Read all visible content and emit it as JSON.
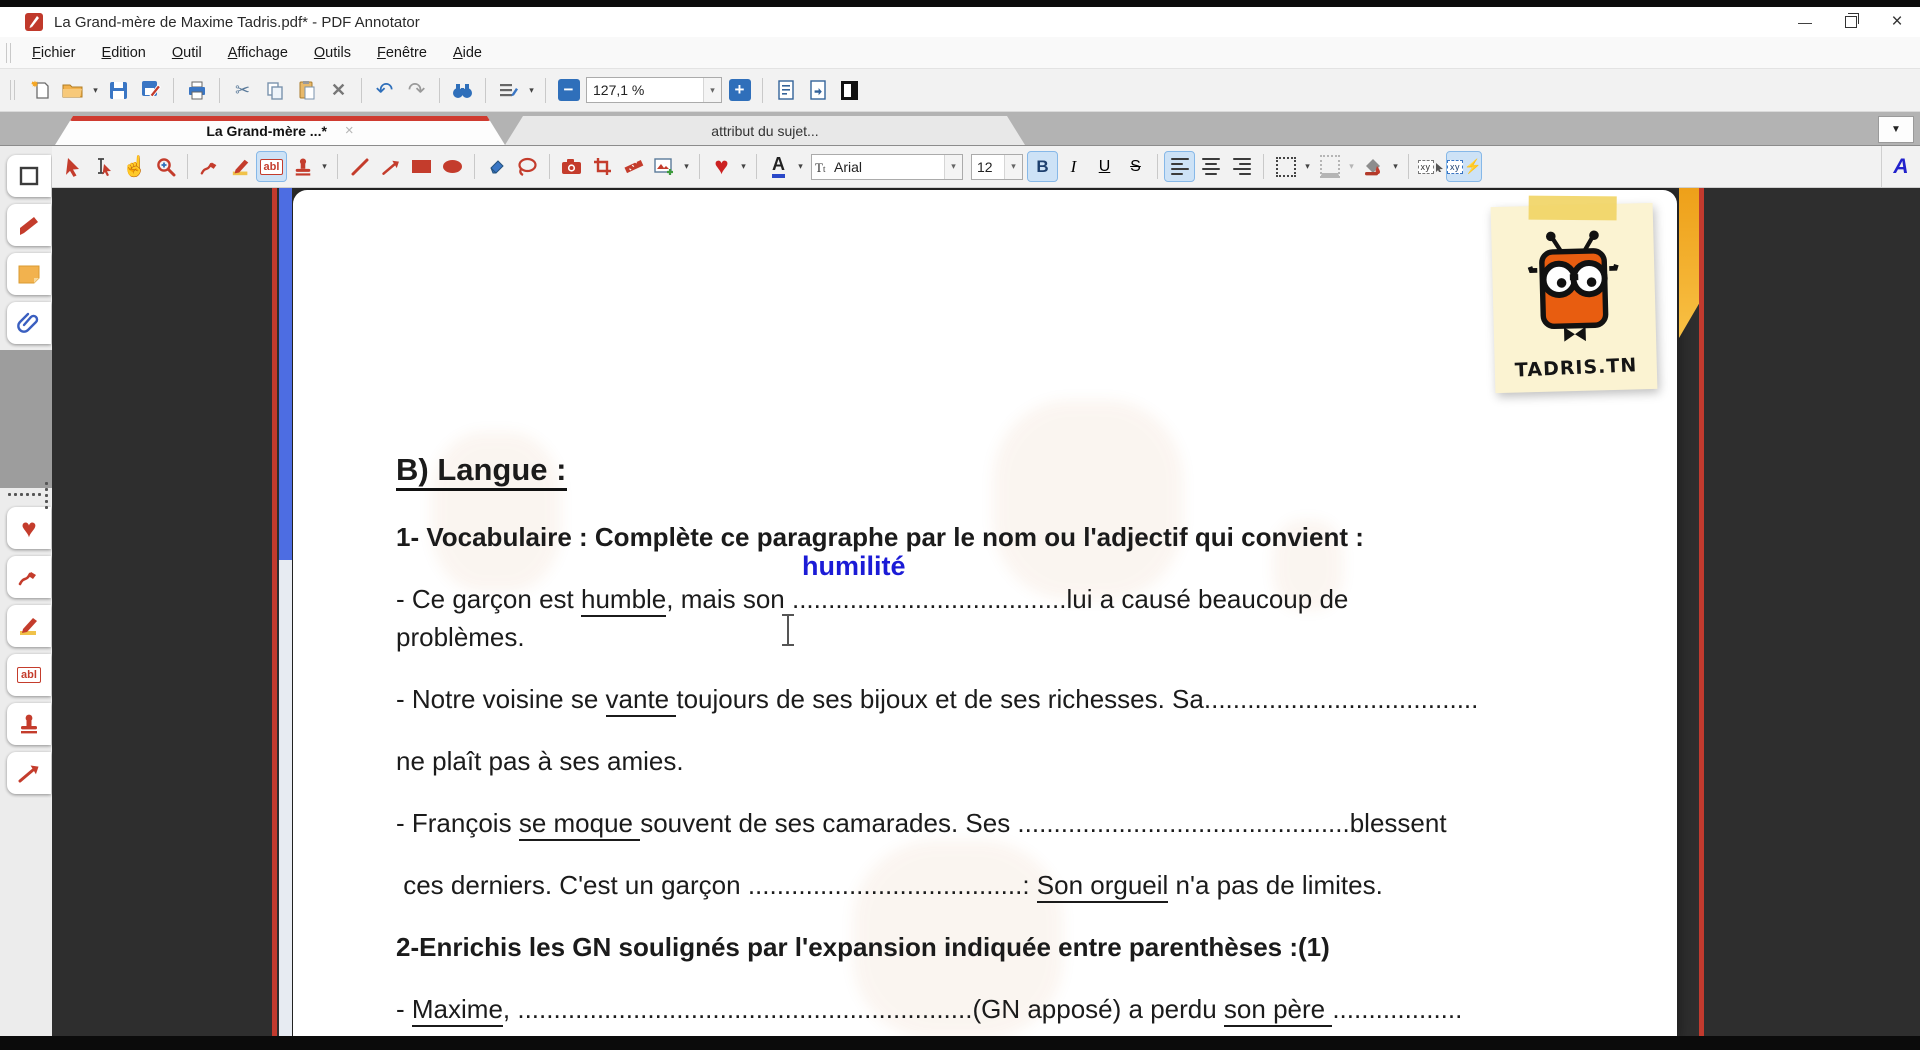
{
  "window": {
    "title": "La Grand-mère de Maxime Tadris.pdf* - PDF Annotator",
    "minimize_glyph": "—",
    "close_glyph": "×"
  },
  "menu": {
    "items": [
      "Fichier",
      "Edition",
      "Outil",
      "Affichage",
      "Outils",
      "Fenêtre",
      "Aide"
    ]
  },
  "toolbar": {
    "zoom_value": "127,1 %"
  },
  "tabs": [
    {
      "label": "La Grand-mère ...*",
      "active": true,
      "close_glyph": "×"
    },
    {
      "label": "attribut du sujet...",
      "active": false
    }
  ],
  "format_toolbar": {
    "text_tool_label": "abl",
    "font_color_letter": "A",
    "font_name": "Arial",
    "font_size": "12",
    "bold": "B",
    "italic": "I",
    "underline": "U",
    "strike": "S",
    "xy_label": "xy",
    "right_panel_letter": "A"
  },
  "sidebar": {
    "text_tool_label": "abl"
  },
  "document": {
    "logo_text": "TADRIS.TN",
    "lines": [
      {
        "cls": "h1",
        "segments": [
          {
            "t": "B) Langue :",
            "s": "bu"
          }
        ]
      },
      {
        "cls": "",
        "segments": [
          {
            "t": "1- Vocabulaire : Complète ce paragraphe par le nom ou l'adjectif qui convient :",
            "s": "b"
          }
        ]
      },
      {
        "cls": "tight",
        "segments": [
          {
            "t": "- Ce garçon est "
          },
          {
            "t": "humble",
            "s": "u"
          },
          {
            "t": ", mais son "
          },
          {
            "t": "......................................",
            "ann": "humilité"
          },
          {
            "t": "lui a causé beaucoup de"
          }
        ]
      },
      {
        "cls": "",
        "segments": [
          {
            "t": "problèmes."
          }
        ]
      },
      {
        "cls": "",
        "segments": [
          {
            "t": "- Notre voisine se "
          },
          {
            "t": "vante ",
            "s": "u"
          },
          {
            "t": "toujours de ses bijoux et de ses richesses. Sa"
          },
          {
            "t": "......................................"
          }
        ]
      },
      {
        "cls": "",
        "segments": [
          {
            "t": "ne plaît pas à ses amies."
          }
        ]
      },
      {
        "cls": "",
        "segments": [
          {
            "t": "- François "
          },
          {
            "t": "se moque ",
            "s": "u"
          },
          {
            "t": "souvent de ses camarades. Ses "
          },
          {
            "t": ".............................................."
          },
          {
            "t": "blessent"
          }
        ]
      },
      {
        "cls": "",
        "segments": [
          {
            "t": " ces derniers. C'est un garçon "
          },
          {
            "t": "......................................"
          },
          {
            "t": ": "
          },
          {
            "t": "Son orgueil",
            "s": "u"
          },
          {
            "t": " n'a pas de limites."
          }
        ]
      },
      {
        "cls": "",
        "segments": [
          {
            "t": "2-Enrichis les GN soulignés par l'expansion indiquée entre parenthèses :(1)",
            "s": "b"
          }
        ]
      },
      {
        "cls": "tight",
        "segments": [
          {
            "t": "- "
          },
          {
            "t": "Maxime",
            "s": "u"
          },
          {
            "t": ", "
          },
          {
            "t": "..............................................................."
          },
          {
            "t": "(GN apposé) a perdu "
          },
          {
            "t": "son père ",
            "s": "u"
          },
          {
            "t": ".................."
          }
        ]
      }
    ]
  },
  "colors": {
    "accent_red": "#c43c2c",
    "accent_blue": "#2f6fba",
    "annotation_blue": "#1b1bd6",
    "ribbon_orange": "#f0a11c",
    "scroll_thumb": "#4d6de2",
    "page_bg": "#ffffff",
    "canvas_bg": "#2e2e2e"
  }
}
